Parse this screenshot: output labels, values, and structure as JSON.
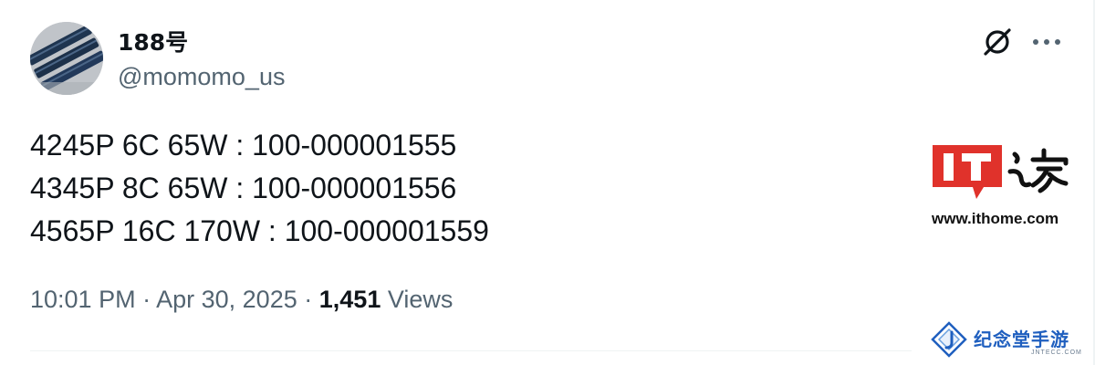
{
  "author": {
    "display_name": "188号",
    "handle": "@momomo_us",
    "avatar": "avatar-image"
  },
  "header_actions": {
    "grok_icon": "grok-icon",
    "more_icon": "more-options-icon"
  },
  "tweet": {
    "lines": [
      "4245P 6C 65W : 100-000001555",
      "4345P 8C 65W : 100-000001556",
      "4565P 16C 170W : 100-000001559"
    ],
    "time": "10:01 PM",
    "separator": "·",
    "date": "Apr 30, 2025",
    "views_count": "1,451",
    "views_label": "Views"
  },
  "watermarks": {
    "ithome_logo_text": "IT之家",
    "ithome_url": "www.ithome.com",
    "jntecc_text": "纪念堂手游",
    "jntecc_sub": "JNTECC.COM",
    "ithome_red": "#e0322b"
  }
}
